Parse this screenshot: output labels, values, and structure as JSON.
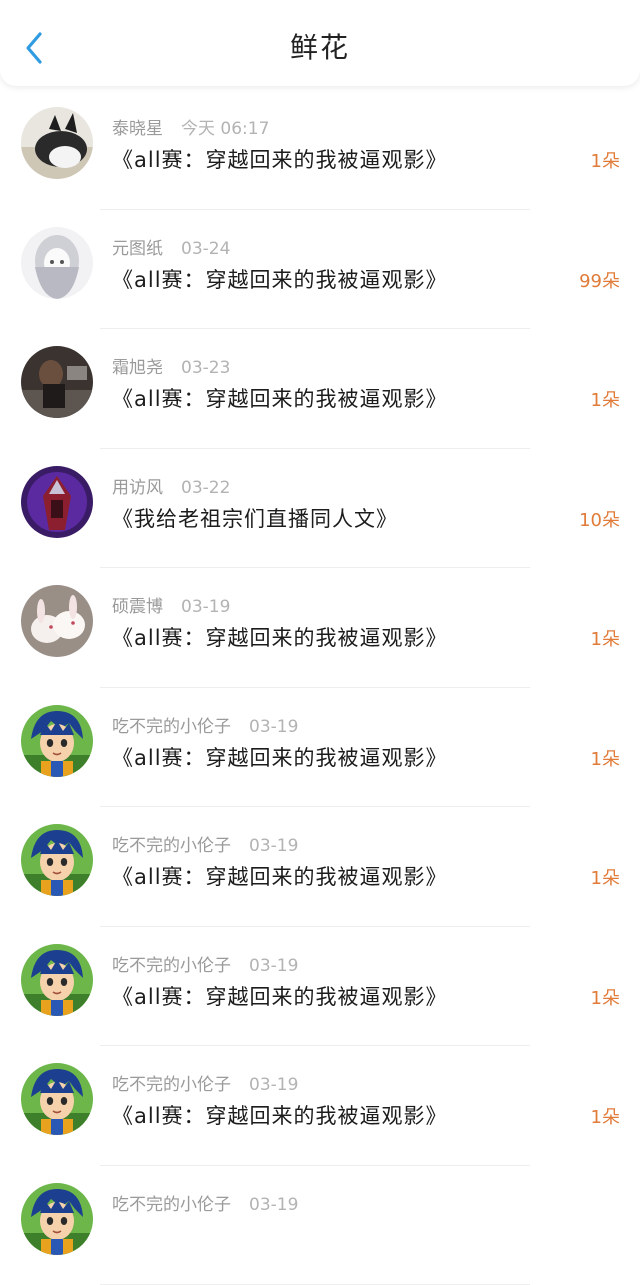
{
  "header": {
    "title": "鲜花"
  },
  "colors": {
    "accent": "#2f9be0",
    "count": "#e07b39"
  },
  "rows": [
    {
      "user": "泰晓星",
      "date": "今天 06:17",
      "book": "《all赛：穿越回来的我被逼观影》",
      "count": "1朵",
      "avatar": "bw-cat"
    },
    {
      "user": "元图纸",
      "date": "03-24",
      "book": "《all赛：穿越回来的我被逼观影》",
      "count": "99朵",
      "avatar": "sketch-girl"
    },
    {
      "user": "霜旭尧",
      "date": "03-23",
      "book": "《all赛：穿越回来的我被逼观影》",
      "count": "1朵",
      "avatar": "dark-photo"
    },
    {
      "user": "用访风",
      "date": "03-22",
      "book": "《我给老祖宗们直播同人文》",
      "count": "10朵",
      "avatar": "purple-knight"
    },
    {
      "user": "硕震博",
      "date": "03-19",
      "book": "《all赛：穿越回来的我被逼观影》",
      "count": "1朵",
      "avatar": "rabbits"
    },
    {
      "user": "吃不完的小伦子",
      "date": "03-19",
      "book": "《all赛：穿越回来的我被逼观影》",
      "count": "1朵",
      "avatar": "anime-boy"
    },
    {
      "user": "吃不完的小伦子",
      "date": "03-19",
      "book": "《all赛：穿越回来的我被逼观影》",
      "count": "1朵",
      "avatar": "anime-boy"
    },
    {
      "user": "吃不完的小伦子",
      "date": "03-19",
      "book": "《all赛：穿越回来的我被逼观影》",
      "count": "1朵",
      "avatar": "anime-boy"
    },
    {
      "user": "吃不完的小伦子",
      "date": "03-19",
      "book": "《all赛：穿越回来的我被逼观影》",
      "count": "1朵",
      "avatar": "anime-boy"
    },
    {
      "user": "吃不完的小伦子",
      "date": "03-19",
      "book": "",
      "count": "",
      "avatar": "anime-boy"
    }
  ]
}
